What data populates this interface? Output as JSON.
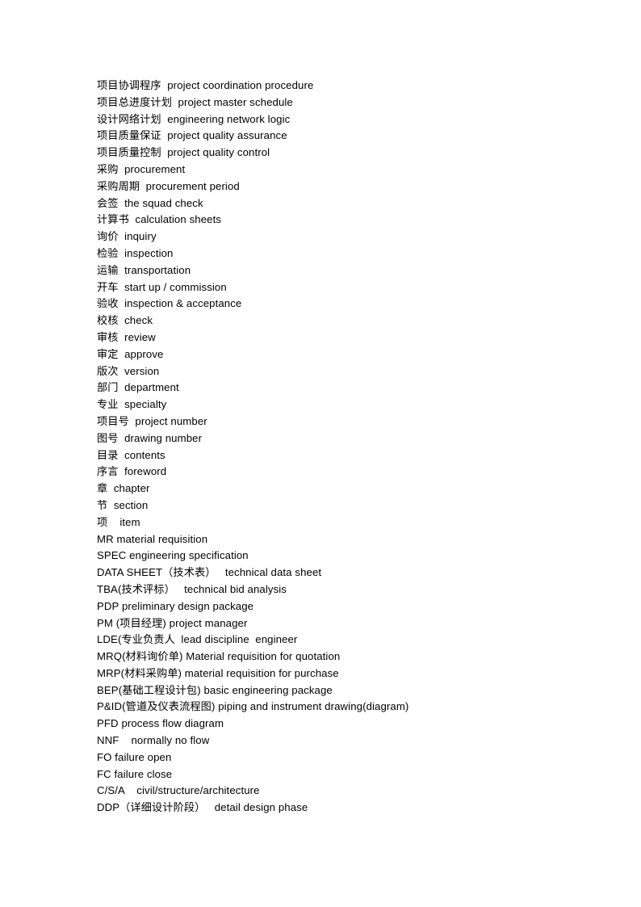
{
  "document": {
    "type": "glossary",
    "page_background": "#ffffff",
    "text_color": "#000000",
    "entries": [
      "项目协调程序  project coordination procedure",
      "项目总进度计划  project master schedule",
      "设计网络计划  engineering network logic",
      "项目质量保证  project quality assurance",
      "项目质量控制  project quality control",
      "采购  procurement",
      "采购周期  procurement period",
      "会签  the squad check",
      "计算书  calculation sheets",
      "询价  inquiry",
      "检验  inspection",
      "运输  transportation",
      "开车  start up / commission",
      "验收  inspection & acceptance",
      "校核  check",
      "审核  review",
      "审定  approve",
      "版次  version",
      "部门  department",
      "专业  specialty",
      "项目号  project number",
      "图号  drawing number",
      "目录  contents",
      "序言  foreword",
      "章  chapter",
      "节  section",
      "项    item",
      "MR material requisition",
      "SPEC engineering specification",
      "DATA SHEET（技术表）   technical data sheet",
      "TBA(技术评标）   technical bid analysis",
      "PDP preliminary design package",
      "PM (项目经理) project manager",
      "LDE(专业负责人  lead discipline  engineer",
      "MRQ(材料询价单) Material requisition for quotation",
      "MRP(材料采购单) material requisition for purchase",
      "BEP(基础工程设计包) basic engineering package",
      "P&ID(管道及仪表流程图) piping and instrument drawing(diagram)",
      "PFD process flow diagram",
      "NNF    normally no flow",
      "FO failure open",
      "FC failure close",
      "C/S/A    civil/structure/architecture",
      "DDP（详细设计阶段）   detail design phase"
    ]
  }
}
